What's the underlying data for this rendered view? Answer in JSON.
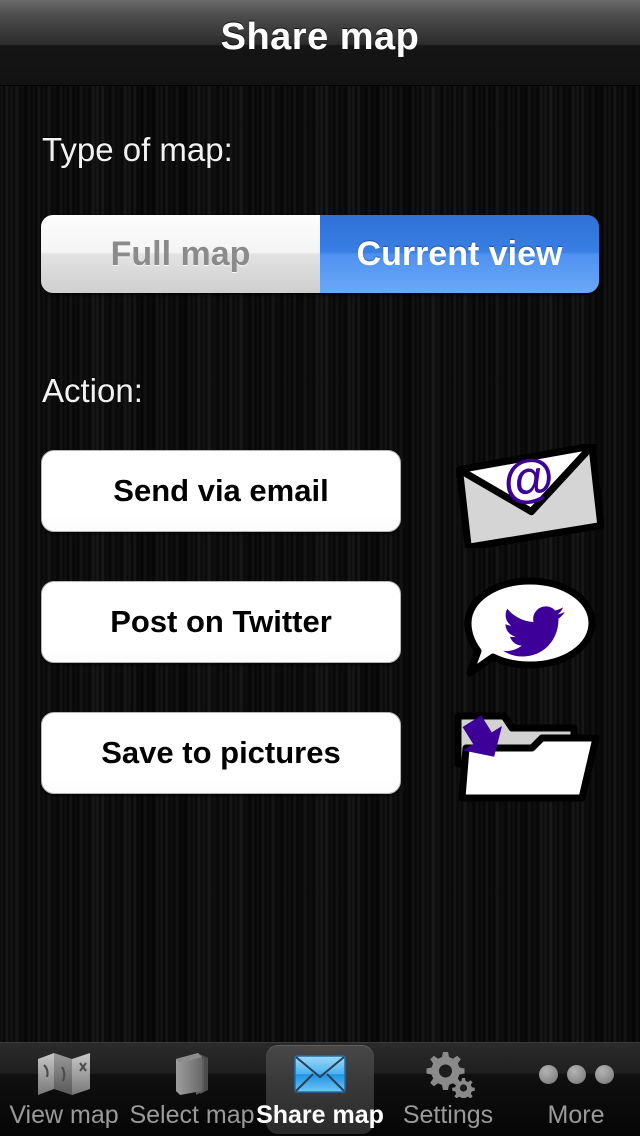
{
  "navbar": {
    "title": "Share map"
  },
  "content": {
    "type_label": "Type of map:",
    "action_label": "Action:",
    "segmented": {
      "name": "map-type-segmented-control",
      "selected": "Current view",
      "options": [
        {
          "label": "Full map",
          "selected": false
        },
        {
          "label": "Current view",
          "selected": true
        }
      ]
    },
    "actions": [
      {
        "label": "Send via email",
        "icon": "envelope-at-icon"
      },
      {
        "label": "Post on Twitter",
        "icon": "twitter-bird-bubble-icon"
      },
      {
        "label": "Save to pictures",
        "icon": "folder-download-icon"
      }
    ]
  },
  "tabbar": {
    "tabs": [
      {
        "label": "View map",
        "icon": "folded-map-icon",
        "active": false
      },
      {
        "label": "Select map",
        "icon": "book-icon",
        "active": false
      },
      {
        "label": "Share map",
        "icon": "blue-envelope-icon",
        "active": true
      },
      {
        "label": "Settings",
        "icon": "gears-icon",
        "active": false
      },
      {
        "label": "More",
        "icon": "ellipsis-icon",
        "active": false
      }
    ]
  },
  "colors": {
    "accent_blue": "#3a7fe4",
    "icon_purple": "#3d0099",
    "background": "#0b0b0b",
    "button_white": "#ffffff"
  }
}
